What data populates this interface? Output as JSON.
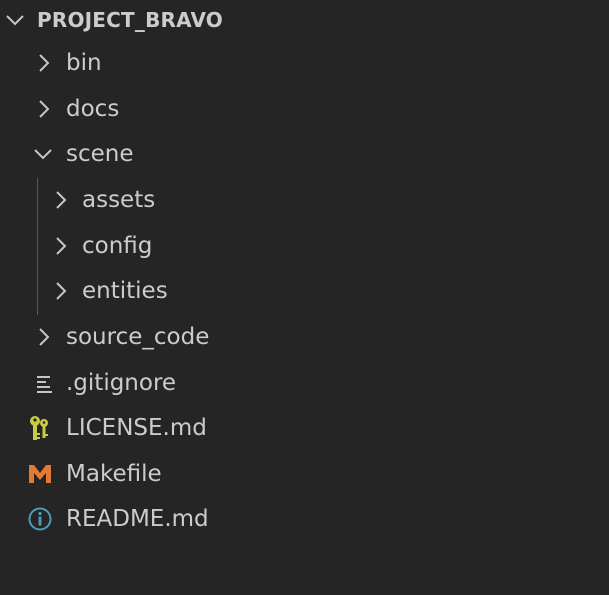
{
  "explorer": {
    "root": {
      "label": "PROJECT_BRAVO",
      "icon": "chevron-down-icon"
    },
    "items": [
      {
        "label": "bin",
        "type": "folder",
        "expanded": false,
        "icon": "chevron-right-icon"
      },
      {
        "label": "docs",
        "type": "folder",
        "expanded": false,
        "icon": "chevron-right-icon"
      },
      {
        "label": "scene",
        "type": "folder",
        "expanded": true,
        "icon": "chevron-down-icon"
      },
      {
        "label": "assets",
        "type": "folder",
        "expanded": false,
        "icon": "chevron-right-icon"
      },
      {
        "label": "config",
        "type": "folder",
        "expanded": false,
        "icon": "chevron-right-icon"
      },
      {
        "label": "entities",
        "type": "folder",
        "expanded": false,
        "icon": "chevron-right-icon"
      },
      {
        "label": "source_code",
        "type": "folder",
        "expanded": false,
        "icon": "chevron-right-icon"
      },
      {
        "label": ".gitignore",
        "type": "file",
        "icon": "lines-icon"
      },
      {
        "label": "LICENSE.md",
        "type": "file",
        "icon": "key-icon"
      },
      {
        "label": "Makefile",
        "type": "file",
        "icon": "makefile-m-icon"
      },
      {
        "label": "README.md",
        "type": "file",
        "icon": "info-icon"
      }
    ]
  },
  "colors": {
    "background": "#252526",
    "text": "#cccccc",
    "chevron": "#c5c5c5",
    "indent_guide": "#585858",
    "license_icon": "#cbcb41",
    "makefile_icon": "#e37933",
    "info_icon": "#519aba"
  }
}
